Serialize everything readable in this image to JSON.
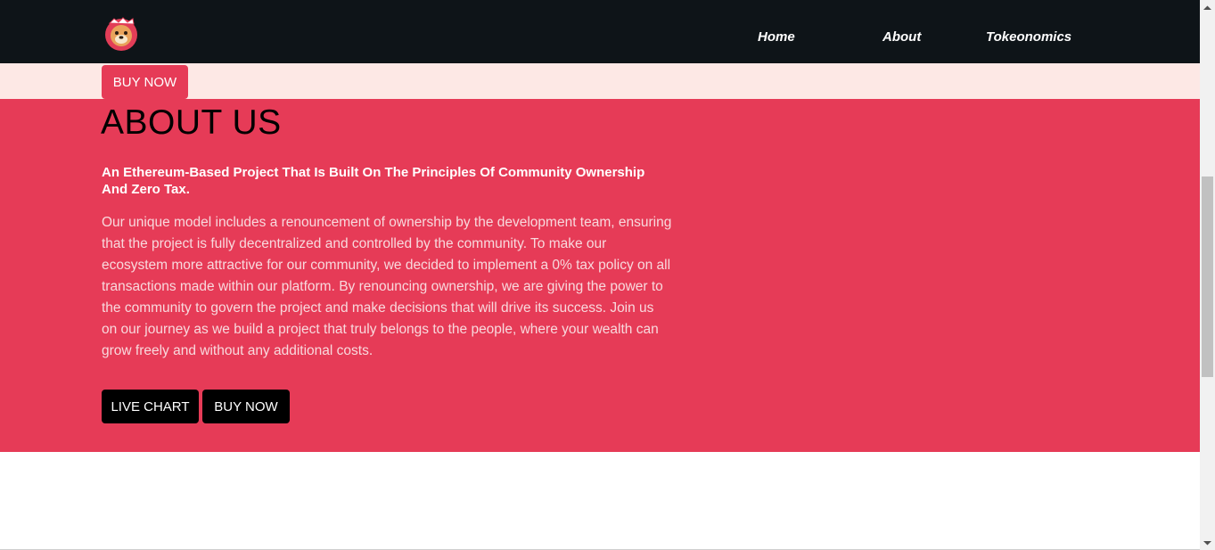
{
  "nav": {
    "logo_alt": "logo",
    "links": [
      "Home",
      "About",
      "Tokeonomics"
    ]
  },
  "band": {
    "buy_label": "BUY NOW"
  },
  "about": {
    "title": "ABOUT US",
    "subtitle": "An Ethereum-Based Project That Is Built On The Principles Of Community Ownership And Zero Tax.",
    "body": "Our unique model includes a renouncement of ownership by the development team, ensuring that the project is fully decentralized and controlled by the community. To make our ecosystem more attractive for our community, we decided to implement a 0% tax policy on all transactions made within our platform. By renouncing ownership, we are giving the power to the community to govern the project and make decisions that will drive its success. Join us on our journey as we build a project that truly belongs to the people, where your wealth can grow freely and without any additional costs.",
    "live_chart_label": "LIVE CHART",
    "buy_label": "BUY NOW"
  },
  "colors": {
    "nav_bg": "#0e1418",
    "accent": "#e63b57",
    "band_bg": "#fde8e5"
  }
}
